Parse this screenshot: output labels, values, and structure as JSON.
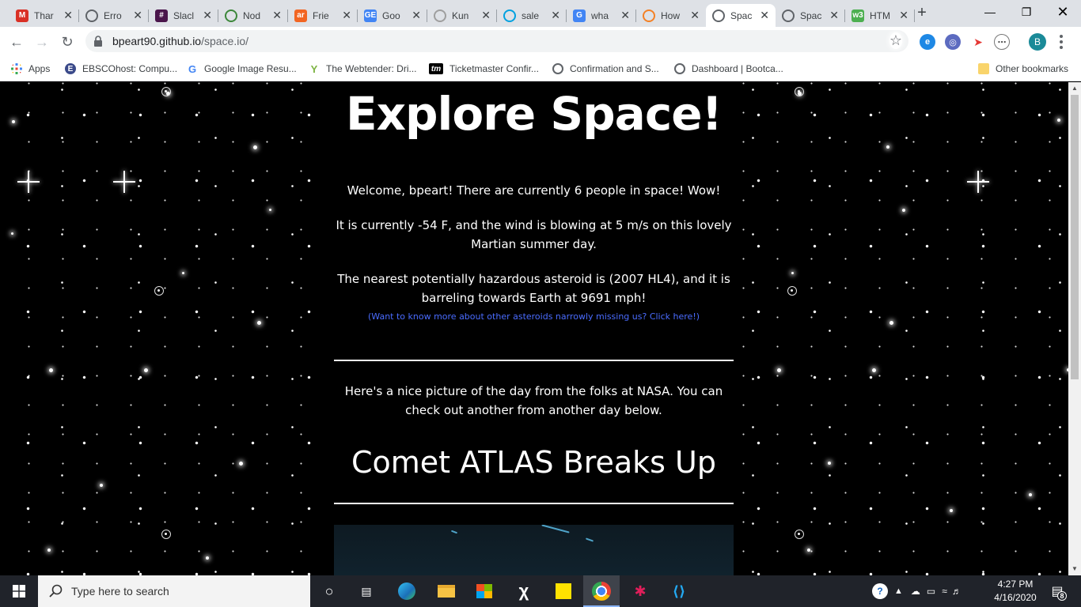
{
  "tabs": [
    {
      "title": "Thar",
      "icon": "gmail-icon",
      "color": "#d93025",
      "glyph": "M"
    },
    {
      "title": "Erro",
      "icon": "globe-icon",
      "color": "#5f6368",
      "glyph": ""
    },
    {
      "title": "Slacl",
      "icon": "slack-icon",
      "color": "#4a154b",
      "glyph": "#"
    },
    {
      "title": "Nod",
      "icon": "nodejs-icon",
      "color": "#3c873a",
      "glyph": ""
    },
    {
      "title": "Frie",
      "icon": "arc-icon",
      "color": "#f26522",
      "glyph": "ar"
    },
    {
      "title": "Goo",
      "icon": "google-forms-icon",
      "color": "#4285f4",
      "glyph": "GE"
    },
    {
      "title": "Kun",
      "icon": "kung-icon",
      "color": "#9e9e9e",
      "glyph": ""
    },
    {
      "title": "sale",
      "icon": "salesforce-icon",
      "color": "#00a1e0",
      "glyph": ""
    },
    {
      "title": "wha",
      "icon": "google-icon",
      "color": "#4285f4",
      "glyph": "G"
    },
    {
      "title": "How",
      "icon": "stackoverflow-icon",
      "color": "#f48024",
      "glyph": ""
    },
    {
      "title": "Spac",
      "icon": "globe-icon",
      "color": "#5f6368",
      "glyph": ""
    },
    {
      "title": "Spac",
      "icon": "globe-icon",
      "color": "#5f6368",
      "glyph": ""
    },
    {
      "title": "HTM",
      "icon": "w3schools-icon",
      "color": "#4caf50",
      "glyph": "w3"
    }
  ],
  "address_bar": {
    "host": "bpeart90.github.io",
    "path": "/space.io/"
  },
  "avatar_letter": "B",
  "bookmarks": [
    {
      "label": "Apps",
      "icon": "apps-grid-icon"
    },
    {
      "label": "EBSCOhost: Compu...",
      "icon": "ebsco-icon"
    },
    {
      "label": "Google Image Resu...",
      "icon": "google-icon"
    },
    {
      "label": "The Webtender: Dri...",
      "icon": "cocktail-icon"
    },
    {
      "label": "Ticketmaster Confir...",
      "icon": "ticketmaster-icon"
    },
    {
      "label": "Confirmation and S...",
      "icon": "globe-icon"
    },
    {
      "label": "Dashboard | Bootca...",
      "icon": "globe-icon"
    },
    {
      "label": "Other bookmarks",
      "icon": "folder-icon"
    }
  ],
  "page": {
    "heading": "Explore Space!",
    "welcome": "Welcome, bpeart! There are currently 6 people in space! Wow!",
    "weather": "It is currently -54 F, and the wind is blowing at 5 m/s on this lovely Martian summer day.",
    "asteroid": "The nearest potentially hazardous asteroid is (2007 HL4), and it is barreling towards Earth at 9691 mph!",
    "asteroid_link": "(Want to know more about other asteroids narrowly missing us? Click here!)",
    "apod_intro": "Here's a nice picture of the day from the folks at NASA. You can check out another from another day below.",
    "apod_title": "Comet ATLAS Breaks Up"
  },
  "taskbar": {
    "search_placeholder": "Type here to search",
    "time": "4:27 PM",
    "date": "4/16/2020",
    "notifications": "8"
  }
}
